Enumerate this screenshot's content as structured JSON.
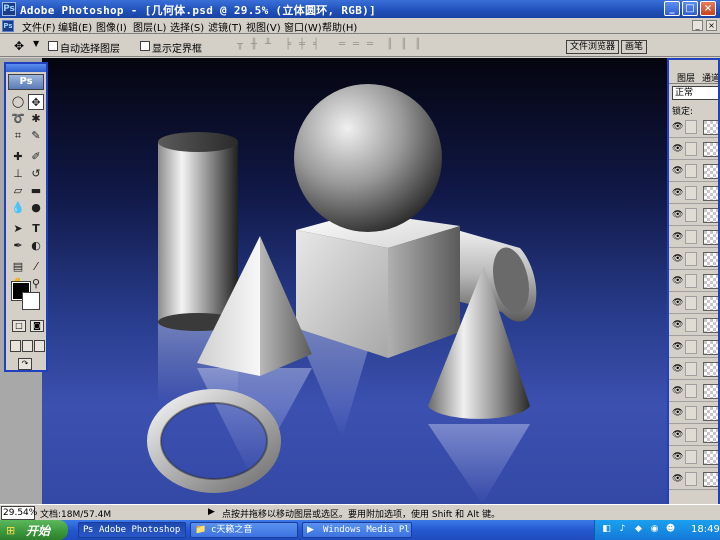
{
  "window": {
    "app_icon": "Ps",
    "title": "Adobe Photoshop - [几何体.psd @ 29.5% (立体圆环, RGB)]",
    "minimize": "_",
    "maximize": "□",
    "close": "×"
  },
  "menu": {
    "doc_icon": "Ps",
    "items": [
      "文件(F)",
      "编辑(E)",
      "图像(I)",
      "图层(L)",
      "选择(S)",
      "滤镜(T)",
      "视图(V)",
      "窗口(W)",
      "帮助(H)"
    ],
    "doc_min": "_",
    "doc_close": "×"
  },
  "options": {
    "move_tool_glyph": "✥",
    "auto_select_label": "自动选择图层",
    "show_bounds_label": "显示定界框",
    "file_browser_tab": "文件浏览器",
    "brushes_tab": "画笔"
  },
  "toolbox": {
    "logo": "Ps"
  },
  "layers_panel": {
    "tab_layers": "图层",
    "tab_channels": "通道",
    "blend_mode": "正常",
    "lock_label": "锁定:",
    "row_count": 17
  },
  "status": {
    "zoom": "29.54%",
    "doc_info": "文档:18M/57.4M",
    "hint_arrow": "▶",
    "hint": "点按并拖移以移动图层或选区。要用附加选项，使用 Shift 和 Alt 键。"
  },
  "taskbar": {
    "start_label": "开始",
    "tasks": [
      {
        "icon": "Ps",
        "label": "Adobe Photoshop ..."
      },
      {
        "icon": "📁",
        "label": "c天籁之音"
      },
      {
        "icon": "▶",
        "label": "Windows Media Pl..."
      }
    ],
    "clock": "18:49"
  },
  "colors": {
    "title_blue": "#1f4fb8",
    "canvas_top": "#05050f",
    "canvas_bottom": "#3448a6",
    "start_green": "#3a963a"
  }
}
